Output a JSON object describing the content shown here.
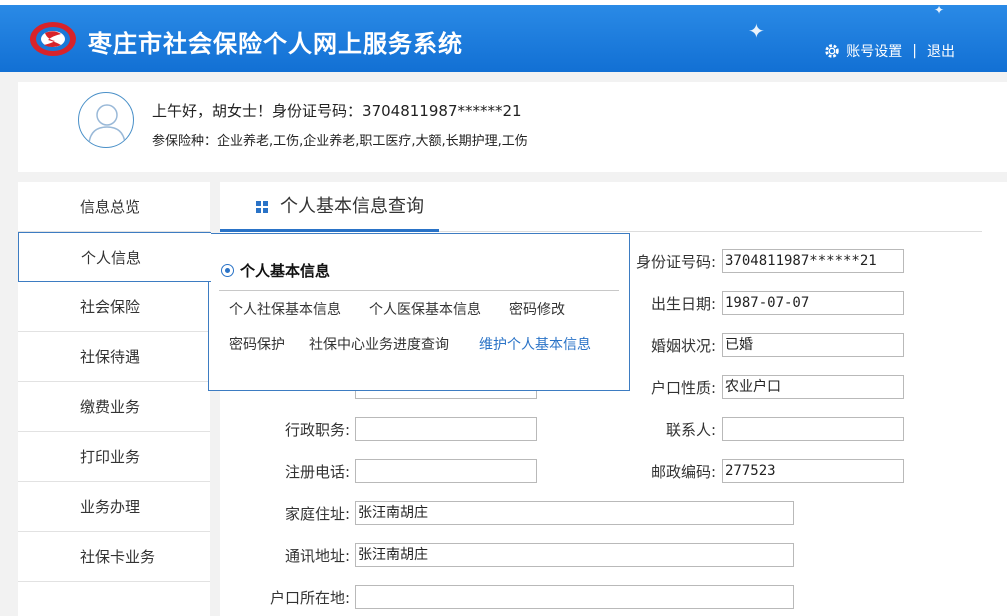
{
  "header": {
    "title": "枣庄市社会保险个人网上服务系统",
    "account_settings": "账号设置",
    "separator": "|",
    "logout": "退出"
  },
  "user": {
    "greeting_prefix": "上午好，",
    "name": "胡女士",
    "greeting_mid": "！身份证号码：",
    "id_number": "3704811987******21",
    "insurance_label": "参保险种：",
    "insurance_types": "企业养老,工伤,企业养老,职工医疗,大额,长期护理,工伤"
  },
  "sidebar": {
    "items": [
      {
        "label": "信息总览"
      },
      {
        "label": "个人信息"
      },
      {
        "label": "社会保险"
      },
      {
        "label": "社保待遇"
      },
      {
        "label": "缴费业务"
      },
      {
        "label": "打印业务"
      },
      {
        "label": "业务办理"
      },
      {
        "label": "社保卡业务"
      }
    ],
    "active_index": 1
  },
  "main": {
    "tab_title": "个人基本信息查询"
  },
  "popup": {
    "title": "个人基本信息",
    "links": [
      "个人社保基本信息",
      "个人医保基本信息",
      "密码修改",
      "密码保护",
      "社保中心业务进度查询",
      "维护个人基本信息"
    ],
    "highlighted_index": 5
  },
  "form": {
    "right": [
      {
        "label": "身份证号码:",
        "value": "3704811987******21"
      },
      {
        "label": "出生日期:",
        "value": "1987-07-07"
      },
      {
        "label": "婚姻状况:",
        "value": "已婚"
      },
      {
        "label": "户口性质:",
        "value": "农业户口"
      },
      {
        "label": "联系人:",
        "value": ""
      },
      {
        "label": "邮政编码:",
        "value": "277523"
      }
    ],
    "left": [
      {
        "label": "行政职务:",
        "value": ""
      },
      {
        "label": "注册电话:",
        "value": ""
      },
      {
        "label": "家庭住址:",
        "value": "张汪南胡庄"
      },
      {
        "label": "通讯地址:",
        "value": "张汪南胡庄"
      },
      {
        "label": "户口所在地:",
        "value": ""
      }
    ]
  },
  "colors": {
    "header_blue": "#1e7ddc",
    "accent": "#2a73c7",
    "link_highlight": "#2a73c7"
  }
}
